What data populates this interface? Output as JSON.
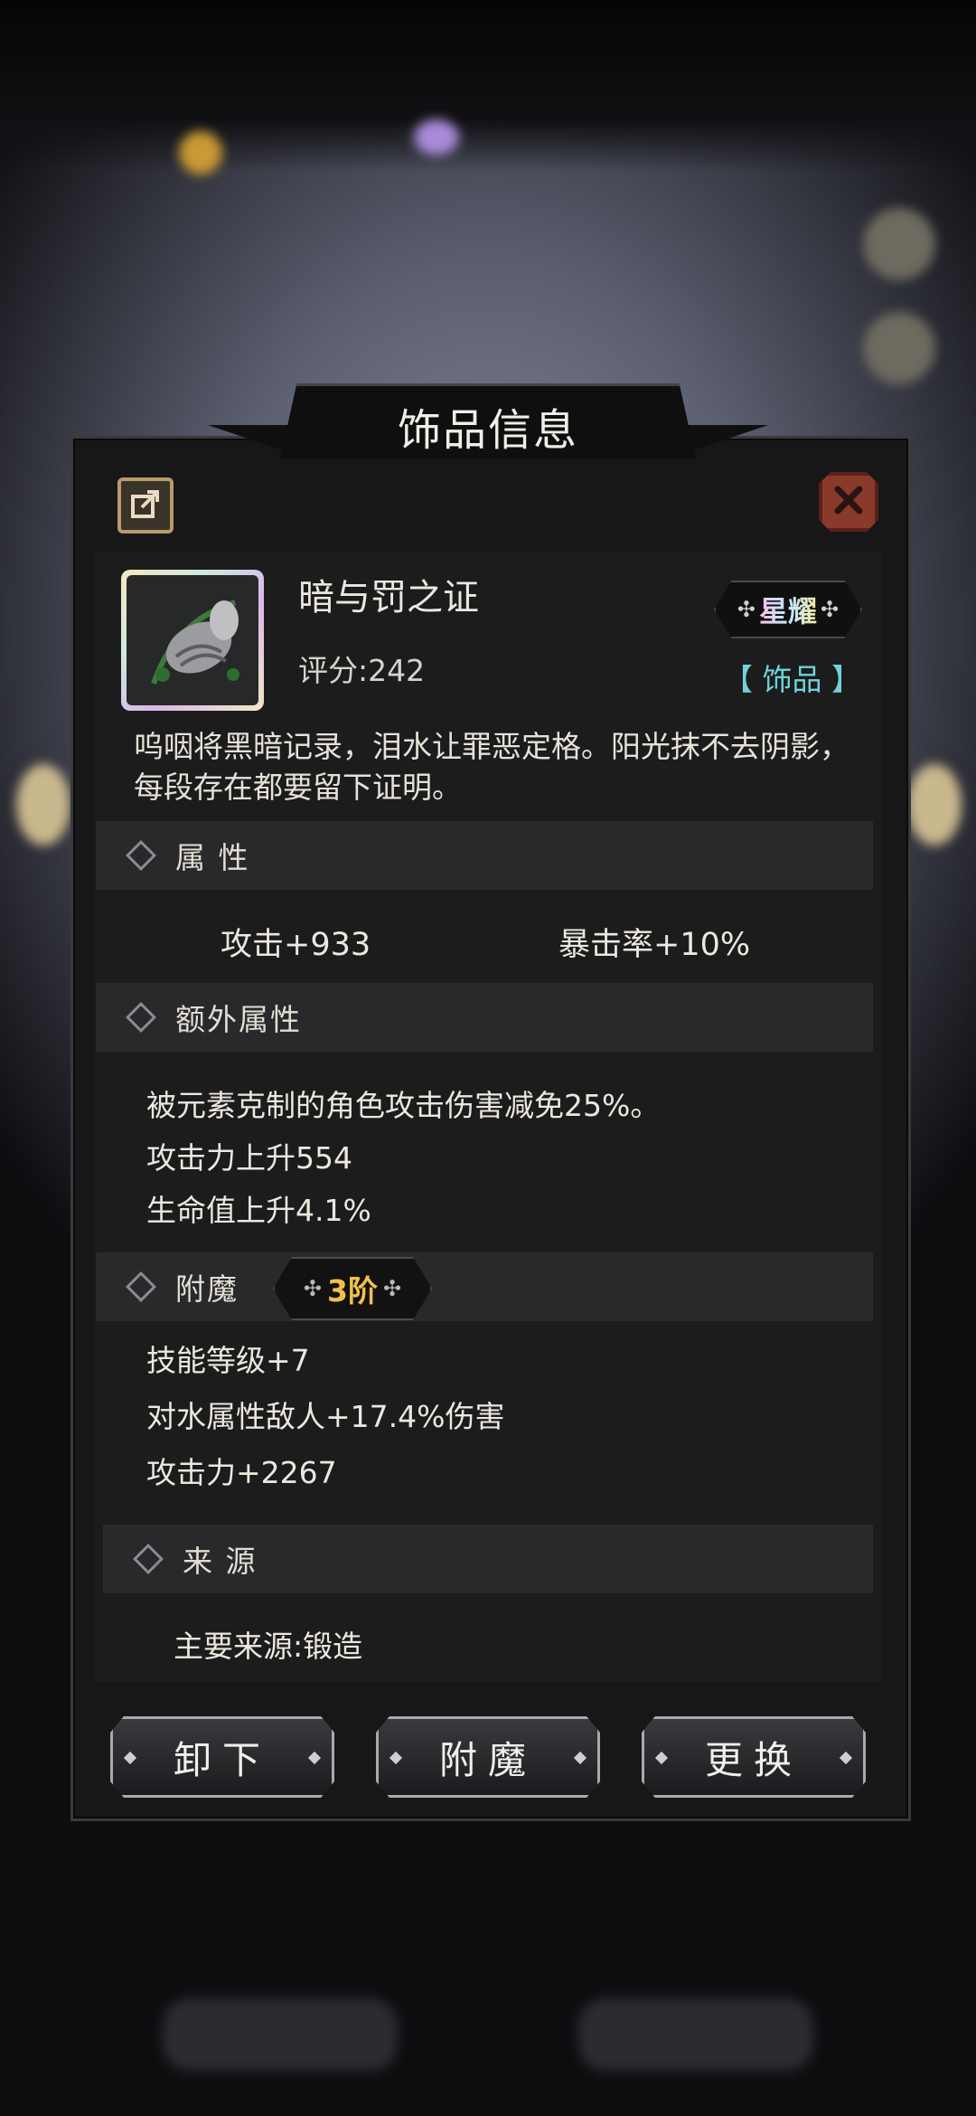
{
  "dialog": {
    "title": "饰品信息"
  },
  "item": {
    "name": "暗与罚之证",
    "score": "评分:242",
    "rarity": "星耀",
    "type": "【 饰品 】",
    "description": "呜咽将黑暗记录，泪水让罪恶定格。阳光抹不去阴影，每段存在都要留下证明。"
  },
  "sections": {
    "attributes": {
      "label": "属 性",
      "values": [
        "攻击+933",
        "暴击率+10%"
      ]
    },
    "extra": {
      "label": "额外属性",
      "lines": [
        "被元素克制的角色攻击伤害减免25%。",
        "攻击力上升554",
        "生命值上升4.1%"
      ]
    },
    "enchant": {
      "label": "附魔",
      "tier": "3阶",
      "lines": [
        "技能等级+7",
        "对水属性敌人+17.4%伤害",
        "攻击力+2267"
      ]
    },
    "source": {
      "label": "来 源",
      "text": "主要来源:锻造"
    }
  },
  "buttons": {
    "unequip": "卸下",
    "enchant": "附魔",
    "replace": "更换"
  },
  "icons": [
    "share-icon",
    "close-icon",
    "item-icon",
    "diamond-icon",
    "star-icon"
  ],
  "colors": {
    "accent_gold": "#f2c04a",
    "type_cyan": "#6fd3d9",
    "close_red": "#8a3a2b"
  }
}
